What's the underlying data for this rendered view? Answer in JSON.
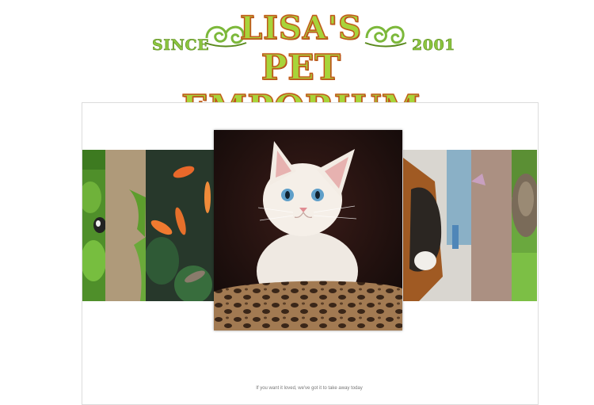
{
  "logo": {
    "since_label": "SINCE",
    "title_line1": "LISA'S",
    "title_line2": "PET EMPORIUM",
    "year_label": "2001",
    "colors": {
      "fill": "#a8d43a",
      "outline": "#c0541a",
      "accent": "#8cc63f"
    }
  },
  "carousel": {
    "slides": [
      {
        "name": "leaf-with-butterfly",
        "position": "far-left"
      },
      {
        "name": "bird-in-foliage",
        "position": "left"
      },
      {
        "name": "koi-fish-pond",
        "position": "near-left"
      },
      {
        "name": "white-kitten",
        "position": "center"
      },
      {
        "name": "boxer-dog",
        "position": "near-right"
      },
      {
        "name": "bird-perched",
        "position": "right"
      },
      {
        "name": "hedgehog-in-grass",
        "position": "far-right"
      }
    ]
  },
  "footer": {
    "tagline": "If you want it loved, we've got it to take away today"
  }
}
